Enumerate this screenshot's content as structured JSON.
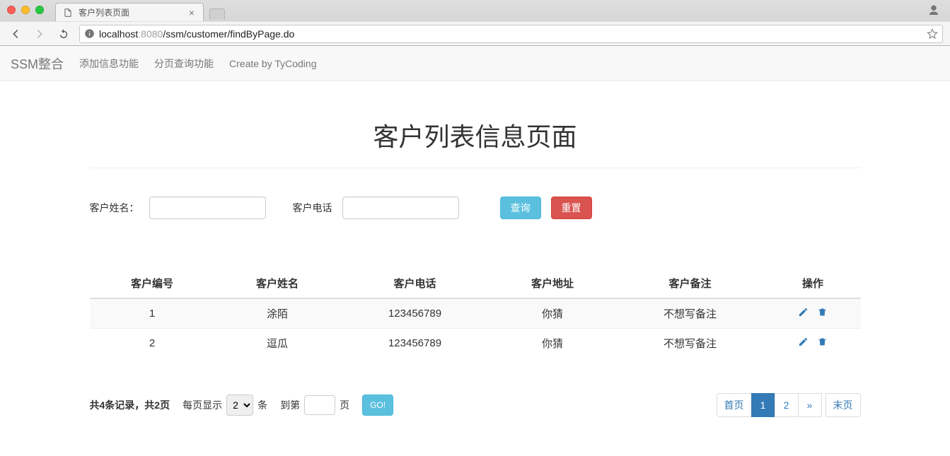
{
  "browser": {
    "tab_title": "客户列表页面",
    "url_host_dark": "localhost",
    "url_host_dim": ":8080",
    "url_path": "/ssm/customer/findByPage.do"
  },
  "navbar": {
    "brand": "SSM整合",
    "links": [
      "添加信息功能",
      "分页查询功能",
      "Create by TyCoding"
    ]
  },
  "page": {
    "title": "客户列表信息页面"
  },
  "search": {
    "name_label": "客户姓名：",
    "phone_label": "客户电话",
    "name_value": "",
    "phone_value": "",
    "query_btn": "查询",
    "reset_btn": "重置"
  },
  "table": {
    "headers": [
      "客户编号",
      "客户姓名",
      "客户电话",
      "客户地址",
      "客户备注",
      "操作"
    ],
    "rows": [
      {
        "id": "1",
        "name": "涂陌",
        "phone": "123456789",
        "address": "你猜",
        "remark": "不想写备注"
      },
      {
        "id": "2",
        "name": "逗瓜",
        "phone": "123456789",
        "address": "你猜",
        "remark": "不想写备注"
      }
    ]
  },
  "footer": {
    "summary": "共4条记录，共2页",
    "per_page_prefix": "每页显示",
    "per_page_value": "2",
    "per_page_suffix": "条",
    "goto_prefix": "到第",
    "goto_value": "",
    "goto_suffix": "页",
    "go_btn": "GO!",
    "pagination": {
      "first": "首页",
      "pages": [
        "1",
        "2"
      ],
      "active": "1",
      "next": "»",
      "last": "末页"
    }
  }
}
